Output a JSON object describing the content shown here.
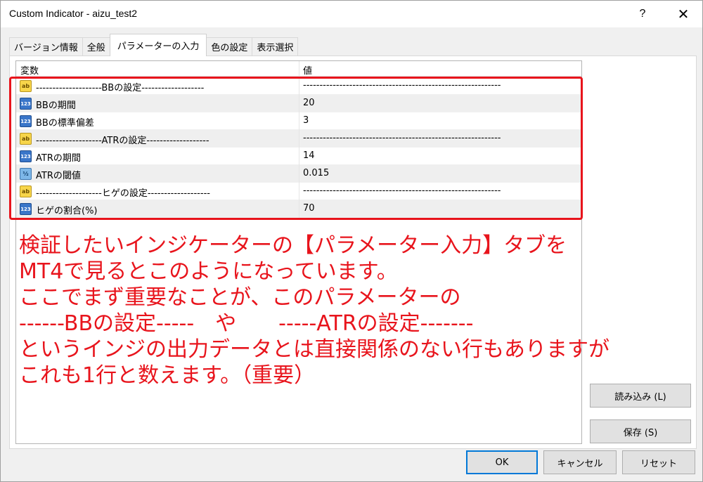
{
  "window": {
    "title": "Custom Indicator - aizu_test2",
    "help_label": "?",
    "close_label": "✕"
  },
  "tabs": [
    {
      "label": "バージョン情報"
    },
    {
      "label": "全般"
    },
    {
      "label": "パラメーターの入力"
    },
    {
      "label": "色の設定"
    },
    {
      "label": "表示選択"
    }
  ],
  "grid": {
    "col_variable": "変数",
    "col_value": "値",
    "rows": [
      {
        "icon": "ab",
        "name": "--------------------BBの設定-------------------",
        "value": "------------------------------------------------------------"
      },
      {
        "icon": "123",
        "name": "BBの期間",
        "value": "20"
      },
      {
        "icon": "123",
        "name": "BBの標準偏差",
        "value": "3"
      },
      {
        "icon": "ab",
        "name": "--------------------ATRの設定-------------------",
        "value": "------------------------------------------------------------"
      },
      {
        "icon": "123",
        "name": "ATRの期間",
        "value": "14"
      },
      {
        "icon": "½",
        "name": "ATRの閾値",
        "value": "0.015"
      },
      {
        "icon": "ab",
        "name": "--------------------ヒゲの設定-------------------",
        "value": "------------------------------------------------------------"
      },
      {
        "icon": "123",
        "name": "ヒゲの割合(%)",
        "value": "70"
      }
    ]
  },
  "annotation": {
    "lines": [
      "検証したいインジケーターの【パラメーター入力】タブを",
      "MT4で見るとこのようになっています。",
      "ここでまず重要なことが、このパラメーターの",
      "------BBの設定-----　や　　-----ATRの設定-------",
      "というインジの出力データとは直接関係のない行もありますが",
      "これも1行と数えます。（重要）"
    ],
    "color": "#e8141c"
  },
  "buttons": {
    "load": "読み込み (L)",
    "save": "保存 (S)",
    "ok": "OK",
    "cancel": "キャンセル",
    "reset": "リセット"
  }
}
